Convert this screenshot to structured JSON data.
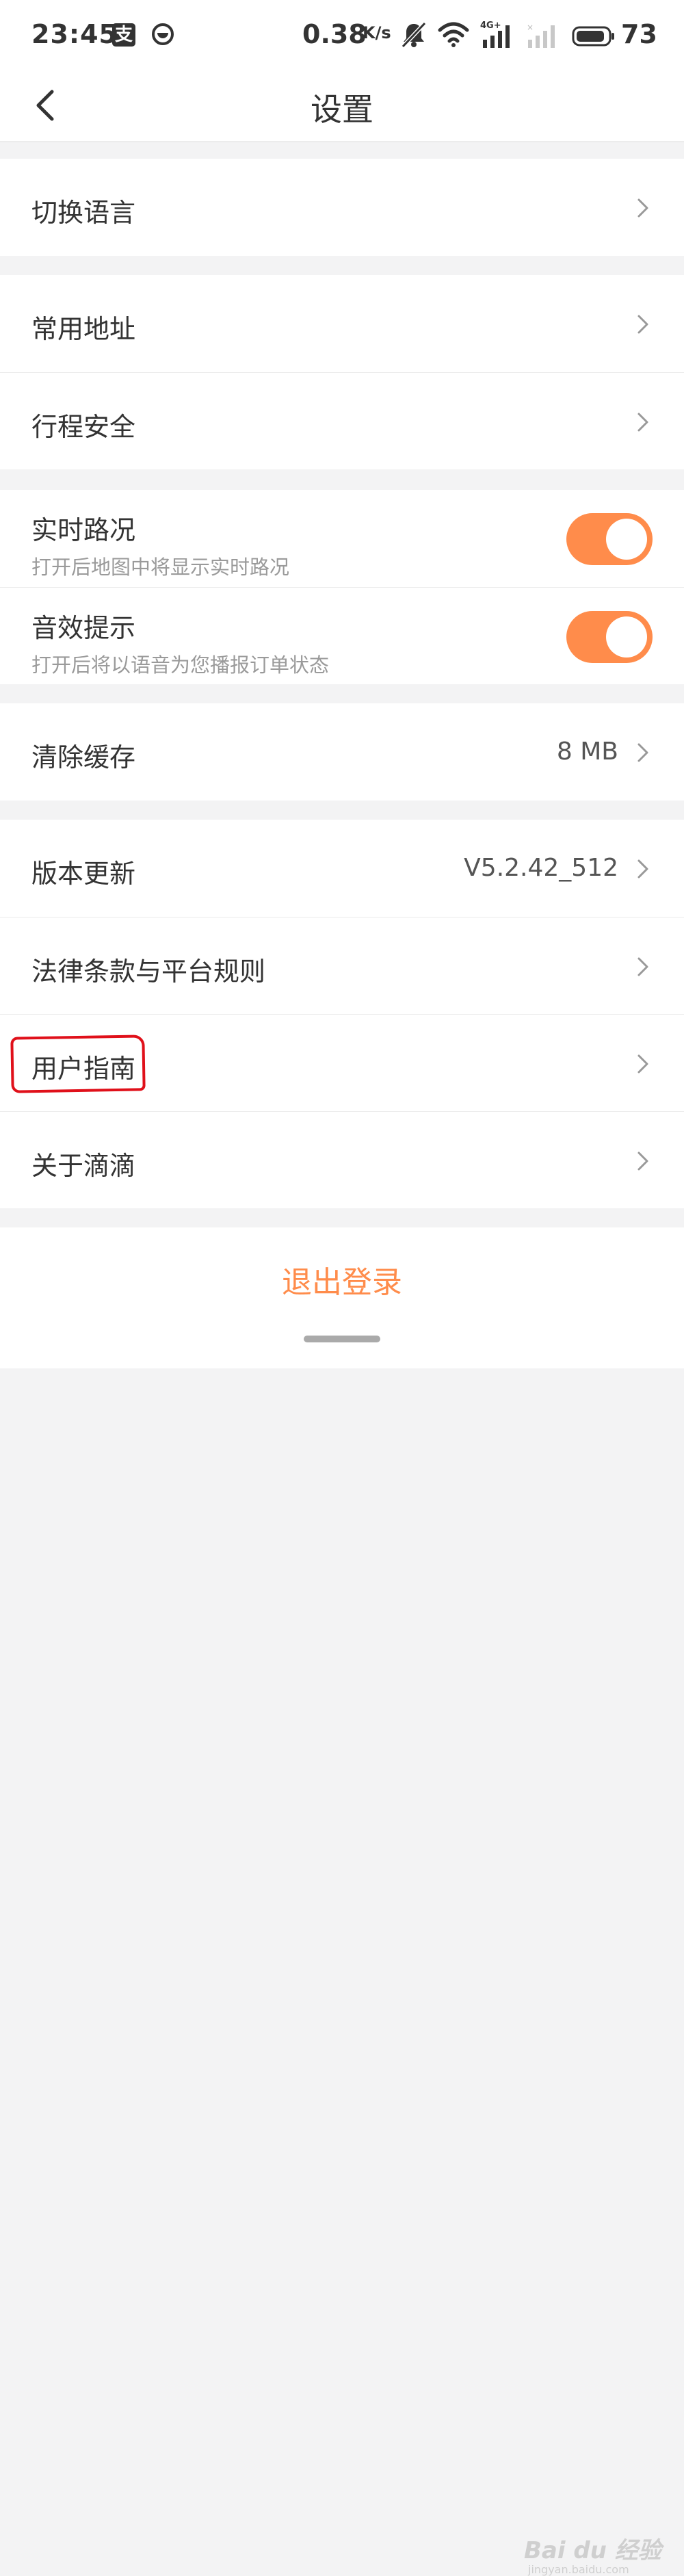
{
  "status_bar": {
    "time": "23:45",
    "alipay_glyph": "支",
    "network_speed": "0.38",
    "speed_unit": "K/s",
    "signal_label": "4G+",
    "battery": "73",
    "icons": [
      "alipay-icon",
      "didi-icon",
      "bell-muted-icon",
      "wifi-icon",
      "signal-4g-icon",
      "signal-empty-icon",
      "battery-icon"
    ]
  },
  "nav": {
    "title": "设置",
    "back_icon": "chevron-left-icon"
  },
  "sections": {
    "language": {
      "label": "切换语言"
    },
    "address": {
      "label": "常用地址"
    },
    "safety": {
      "label": "行程安全"
    },
    "traffic": {
      "label": "实时路况",
      "sub": "打开后地图中将显示实时路况",
      "on": true
    },
    "sound": {
      "label": "音效提示",
      "sub": "打开后将以语音为您播报订单状态",
      "on": true
    },
    "cache": {
      "label": "清除缓存",
      "value": "8 MB"
    },
    "version": {
      "label": "版本更新",
      "value": "V5.2.42_512"
    },
    "legal": {
      "label": "法律条款与平台规则"
    },
    "guide": {
      "label": "用户指南"
    },
    "about": {
      "label": "关于滴滴"
    }
  },
  "logout": {
    "label": "退出登录"
  },
  "watermark": {
    "text": "Bai du 经验",
    "sub": "jingyan.baidu.com"
  },
  "colors": {
    "accent": "#ff8c4b",
    "highlight": "#e0101a",
    "background": "#f3f3f4"
  }
}
